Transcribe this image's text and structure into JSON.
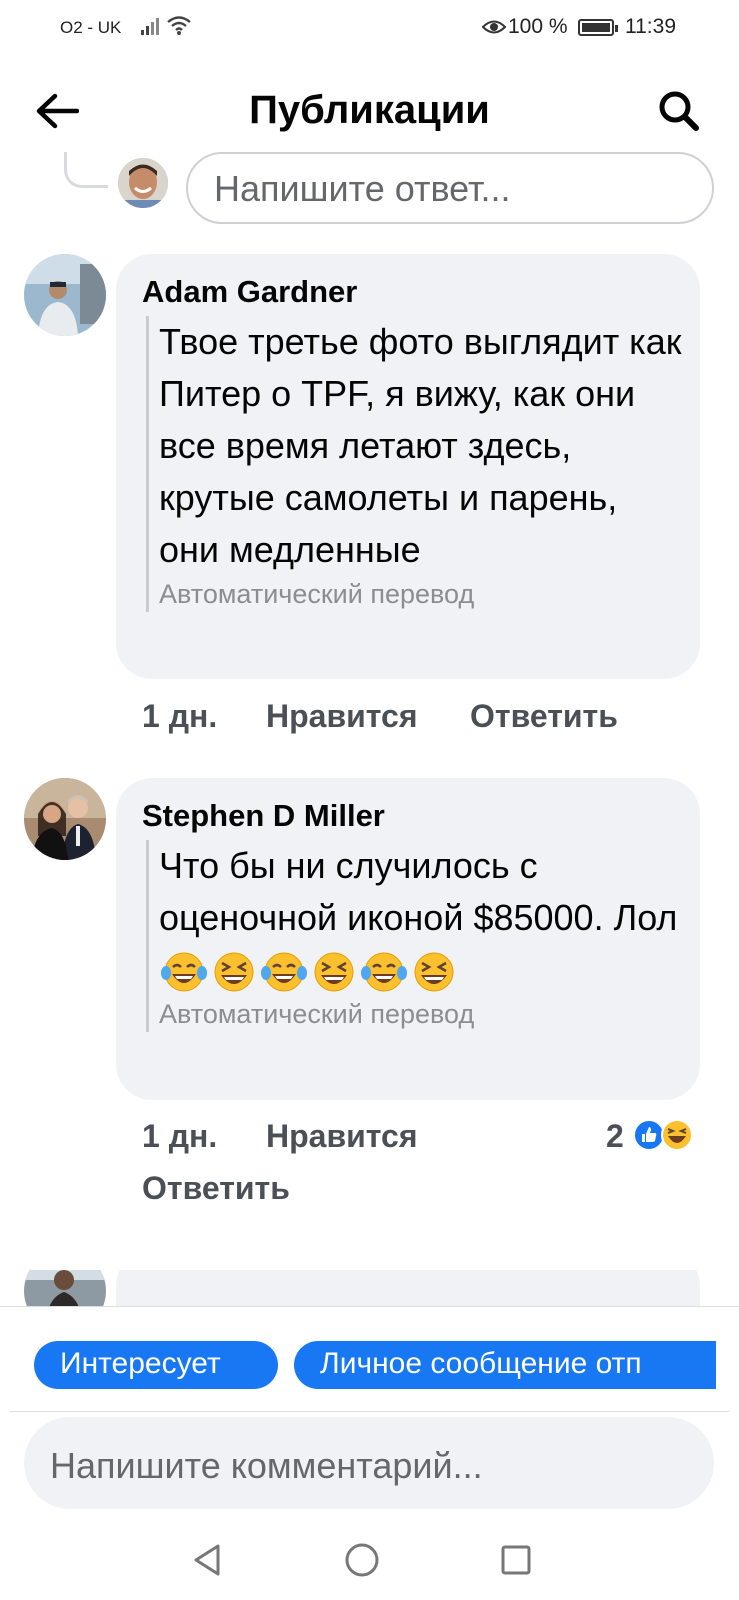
{
  "status_bar": {
    "carrier": "O2 - UK",
    "battery_percent": "100 %",
    "battery_level": 1.0,
    "time": "11:39",
    "icons": [
      "signal-icon",
      "wifi-icon",
      "eye-icon",
      "battery-icon"
    ]
  },
  "header": {
    "title": "Публикации",
    "back_icon": "arrow-left-icon",
    "search_icon": "search-icon"
  },
  "reply_box": {
    "placeholder": "Напишите ответ..."
  },
  "comments": [
    {
      "author": "Adam Gardner",
      "text": "Твое третье фото выглядит как Питер о TPF, я вижу, как они все время летают здесь, крутые самолеты и парень, они медленные",
      "translation_note": "Автоматический перевод",
      "time": "1 дн.",
      "like_label": "Нравится",
      "reply_label": "Ответить"
    },
    {
      "author": "Stephen D Miller",
      "text": "Что бы ни случилось с оценочной иконой $85000. Лол",
      "emojis": [
        "face-with-tears-of-joy",
        "grinning-squinting-face",
        "face-with-tears-of-joy",
        "grinning-squinting-face",
        "face-with-tears-of-joy",
        "grinning-squinting-face"
      ],
      "translation_note": "Автоматический перевод",
      "time": "1 дн.",
      "like_label": "Нравится",
      "reply_label": "Ответить",
      "reaction_count": "2",
      "reactions": [
        "like-icon",
        "haha-icon"
      ]
    }
  ],
  "bottom": {
    "chips": [
      "Интересует",
      "Личное сообщение отп"
    ],
    "comment_placeholder": "Напишите комментарий..."
  },
  "nav_bar": {
    "icons": [
      "back-triangle-icon",
      "home-circle-icon",
      "recents-square-icon"
    ]
  },
  "colors": {
    "accent": "#1877f2",
    "bubble": "#f0f2f5",
    "secondary_text": "#65676b",
    "muted_text": "#8a8d91"
  }
}
